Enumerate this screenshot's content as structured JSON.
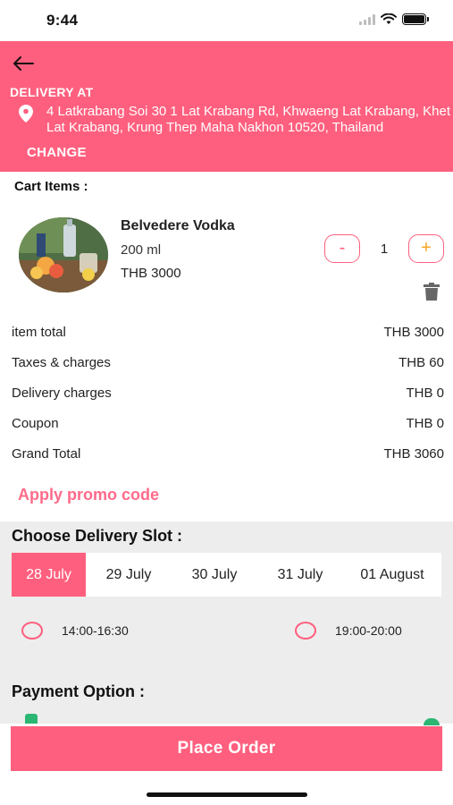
{
  "status_bar": {
    "time": "9:44"
  },
  "header": {
    "delivery_label": "DELIVERY AT",
    "address": "4 Latkrabang Soi 30 1 Lat Krabang Rd, Khwaeng Lat Krabang, Khet Lat Krabang, Krung Thep Maha Nakhon 10520, Thailand",
    "change_label": "CHANGE",
    "background_color": "#ff5f7e"
  },
  "cart": {
    "title": "Cart Items :",
    "item": {
      "name": "Belvedere Vodka",
      "size": "200 ml",
      "price": "THB 3000",
      "quantity": "1",
      "minus_label": "-",
      "plus_label": "+"
    }
  },
  "summary": [
    {
      "label": "item total",
      "value": "THB 3000"
    },
    {
      "label": "Taxes & charges",
      "value": "THB 60"
    },
    {
      "label": "Delivery charges",
      "value": "THB 0"
    },
    {
      "label": "Coupon",
      "value": "THB 0"
    },
    {
      "label": "Grand Total",
      "value": "THB 3060"
    }
  ],
  "promo": {
    "label": "Apply promo code"
  },
  "delivery_slot": {
    "title": "Choose Delivery Slot :",
    "dates": [
      "28 July",
      "29 July",
      "30 July",
      "31 July",
      "01 August"
    ],
    "selected_date": "28 July",
    "times": [
      "14:00-16:30",
      "19:00-20:00"
    ]
  },
  "payment": {
    "title": "Payment Option :"
  },
  "place_order": {
    "label": "Place Order"
  },
  "colors": {
    "accent": "#ff5f7e",
    "promo": "#ff6b8a",
    "plus": "#f5a623"
  },
  "icons": [
    "back-arrow-icon",
    "location-pin-icon",
    "trash-icon",
    "wifi-icon",
    "signal-icon",
    "battery-icon"
  ]
}
